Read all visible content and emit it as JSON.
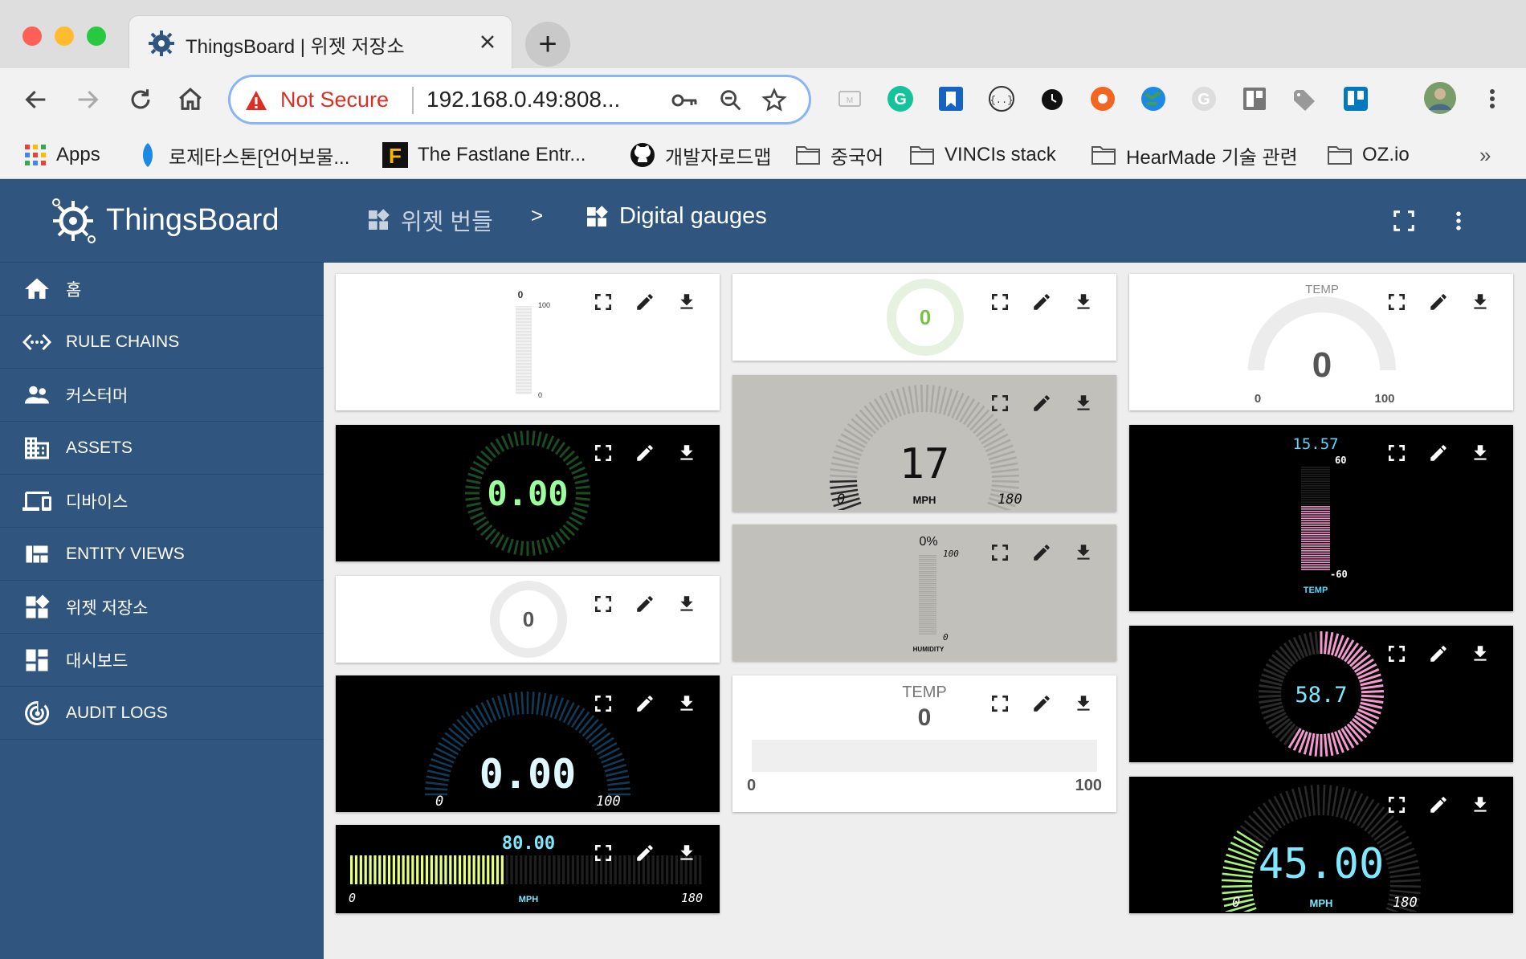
{
  "browser": {
    "tab_title": "ThingsBoard | 위젯 저장소",
    "not_secure": "Not Secure",
    "url": "192.168.0.49:808...",
    "bookmarks": [
      "Apps",
      "로제타스톤[언어보물...",
      "The Fastlane Entr...",
      "개발자로드맵",
      "중국어",
      "VINCIs stack",
      "HearMade 기술 관련",
      "OZ.io"
    ],
    "more_bookmarks": "»"
  },
  "app": {
    "logo_text": "ThingsBoard",
    "breadcrumb": {
      "parent": "위젯 번들",
      "separator": ">",
      "current": "Digital gauges"
    }
  },
  "sidebar": {
    "items": [
      {
        "label": "홈",
        "icon": "home-icon"
      },
      {
        "label": "RULE CHAINS",
        "icon": "settings-ethernet-icon"
      },
      {
        "label": "커스터머",
        "icon": "people-icon"
      },
      {
        "label": "ASSETS",
        "icon": "domain-icon"
      },
      {
        "label": "디바이스",
        "icon": "devices-icon"
      },
      {
        "label": "ENTITY VIEWS",
        "icon": "view-quilt-icon"
      },
      {
        "label": "위젯 저장소",
        "icon": "widgets-icon"
      },
      {
        "label": "대시보드",
        "icon": "dashboards-icon"
      },
      {
        "label": "AUDIT LOGS",
        "icon": "track-changes-icon"
      }
    ]
  },
  "colors": {
    "primary": "#305680",
    "content_bg": "#eeeeee",
    "warning": "#d93025"
  },
  "widgets": {
    "w1": {
      "top": "0",
      "high": "100",
      "low": "0",
      "fill": 0
    },
    "w2": {
      "value": "0.00",
      "fill": 0
    },
    "w3": {
      "value": "0",
      "fill": 0
    },
    "w4": {
      "value": "0.00",
      "min": "0",
      "max": "100",
      "fill": 0
    },
    "w5": {
      "value": "80.00",
      "min": "0",
      "max": "180",
      "unit": "MPH",
      "fill": 0.44
    },
    "w6": {
      "value": "0",
      "fill": 0
    },
    "w7": {
      "value": "17",
      "min": "0",
      "max": "180",
      "unit": "MPH",
      "fill": 0.09
    },
    "w8": {
      "top": "0%",
      "high": "100",
      "low": "0",
      "label": "HUMIDITY",
      "fill": 0
    },
    "w9": {
      "title": "TEMP",
      "value": "0",
      "min": "0",
      "max": "100",
      "fill": 0
    },
    "w10": {
      "title": "TEMP",
      "value": "0",
      "min": "0",
      "max": "100",
      "fill": 0
    },
    "w11": {
      "value": "15.57",
      "high": "60",
      "low": "-60",
      "label": "TEMP",
      "fill": 0.63
    },
    "w12": {
      "value": "58.7",
      "fill": 0.587
    },
    "w13": {
      "value": "45.00",
      "min": "0",
      "max": "180",
      "unit": "MPH",
      "fill": 0.25
    }
  }
}
